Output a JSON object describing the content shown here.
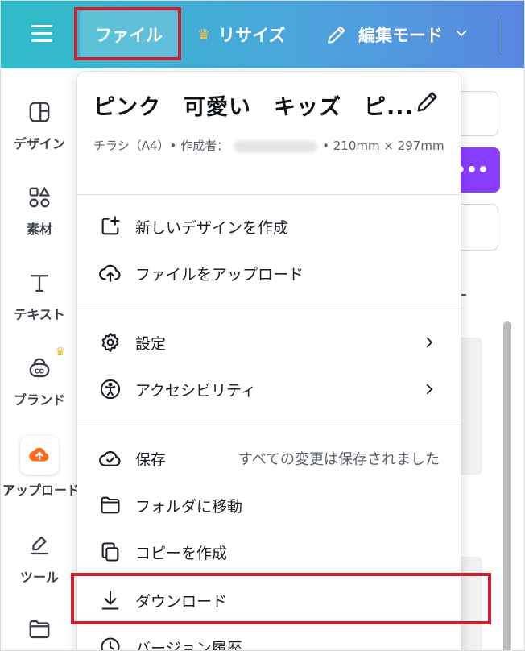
{
  "header": {
    "file_label": "ファイル",
    "resize_label": "リサイズ",
    "edit_mode_label": "編集モード",
    "icons": [
      "hamburger-icon",
      "crown-icon",
      "pencil-icon",
      "chevron-down-icon"
    ]
  },
  "sidebar": {
    "items": [
      {
        "label": "デザイン",
        "icon": "layout-icon"
      },
      {
        "label": "素材",
        "icon": "elements-icon"
      },
      {
        "label": "テキスト",
        "icon": "text-icon"
      },
      {
        "label": "ブランド",
        "icon": "brand-icon"
      },
      {
        "label": "アップロード",
        "icon": "upload-cloud-icon"
      },
      {
        "label": "ツール",
        "icon": "draw-tool-icon"
      },
      {
        "label": "",
        "icon": "folder-icon"
      }
    ]
  },
  "menu": {
    "title": "ピンク　可愛い　キッズ　ピ...",
    "meta_prefix": "チラシ（A4）• 作成者：",
    "meta_suffix": "• 210mm × 297mm",
    "items": {
      "new_design": "新しいデザインを作成",
      "upload_file": "ファイルをアップロード",
      "settings": "設定",
      "accessibility": "アクセシビリティ",
      "save": "保存",
      "save_status": "すべての変更は保存されました",
      "move_folder": "フォルダに移動",
      "make_copy": "コピーを作成",
      "download": "ダウンロード",
      "version_history": "バージョン履歴"
    }
  },
  "right_panel": {
    "more_label": "•••"
  },
  "colors": {
    "accent_purple": "#8b3dff",
    "highlight_red": "#c8202e",
    "header_start": "#2fbdc8",
    "header_end": "#5a86e0"
  }
}
